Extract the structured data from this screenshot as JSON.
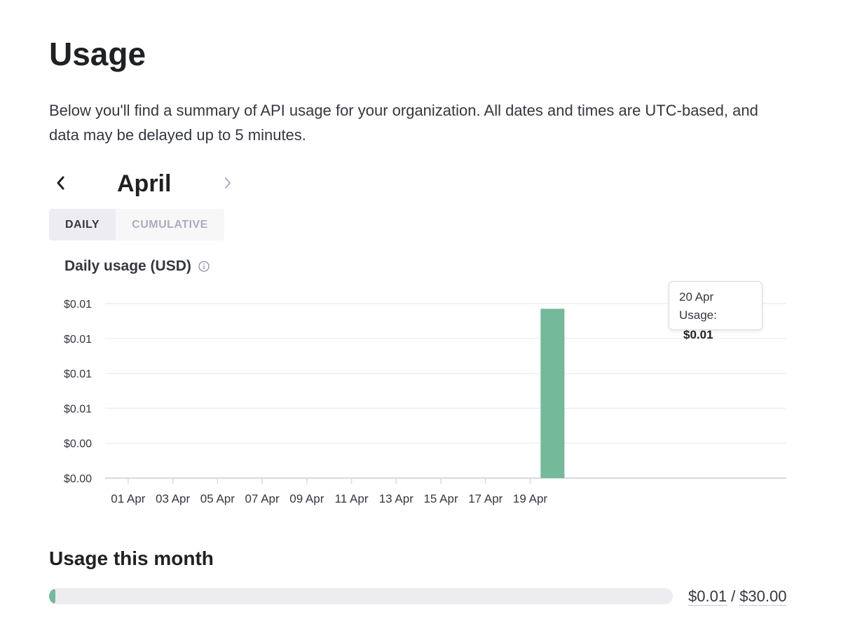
{
  "page": {
    "title": "Usage",
    "description": "Below you'll find a summary of API usage for your organization. All dates and times are UTC-based, and data may be delayed up to 5 minutes."
  },
  "month_nav": {
    "label": "April",
    "prev_icon": "chevron-left-icon",
    "next_icon": "chevron-right-icon"
  },
  "tabs": [
    {
      "label": "DAILY",
      "active": true
    },
    {
      "label": "CUMULATIVE",
      "active": false
    }
  ],
  "chart_title": "Daily usage (USD)",
  "chart_data": {
    "type": "bar",
    "x_tick_labels": [
      "01 Apr",
      "03 Apr",
      "05 Apr",
      "07 Apr",
      "09 Apr",
      "11 Apr",
      "13 Apr",
      "15 Apr",
      "17 Apr",
      "19 Apr"
    ],
    "y_tick_labels": [
      "$0.00",
      "$0.00",
      "$0.01",
      "$0.01",
      "$0.01",
      "$0.01"
    ],
    "ylim": [
      0,
      0.01
    ],
    "series": [
      {
        "x": [
          "20 Apr"
        ],
        "values": [
          0.0097
        ]
      }
    ],
    "bar_color": "#74b99a",
    "grid": true
  },
  "tooltip": {
    "date": "20 Apr",
    "label": "Usage:",
    "value": "$0.01"
  },
  "usage_this_month": {
    "title": "Usage this month",
    "used": "$0.01",
    "separator": "/",
    "limit": "$30.00",
    "fraction": 0.0003
  },
  "colors": {
    "accent": "#74b99a",
    "text": "#202123",
    "muted": "#acacbe"
  }
}
